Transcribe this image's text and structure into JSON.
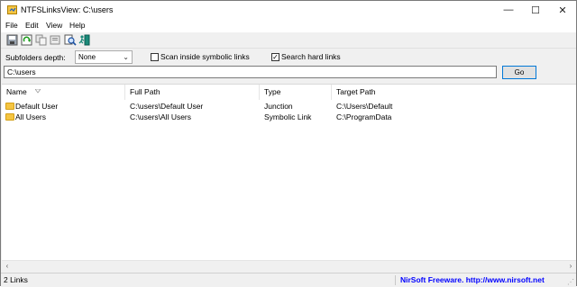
{
  "window": {
    "title": "NTFSLinksView:  C:\\users",
    "minimize": "—",
    "maximize": "☐",
    "close": "✕"
  },
  "menu": [
    "File",
    "Edit",
    "View",
    "Help"
  ],
  "toolbar_icons": [
    "save-icon",
    "refresh-icon",
    "copy-icon",
    "properties-icon",
    "find-icon",
    "exit-icon"
  ],
  "options": {
    "depth_label": "Subfolders depth:",
    "depth_value": "None",
    "scan_symbolic_label": "Scan inside symbolic links",
    "scan_symbolic_checked": false,
    "hard_links_label": "Search hard links",
    "hard_links_checked": true
  },
  "path": {
    "value": "C:\\users",
    "go_label": "Go"
  },
  "columns": [
    "Name",
    "Full Path",
    "Type",
    "Target Path"
  ],
  "rows": [
    {
      "name": "Default User",
      "full_path": "C:\\users\\Default User",
      "type": "Junction",
      "target": "C:\\Users\\Default"
    },
    {
      "name": "All Users",
      "full_path": "C:\\users\\All Users",
      "type": "Symbolic Link",
      "target": "C:\\ProgramData"
    }
  ],
  "status": {
    "count": "2 Links",
    "link": "NirSoft Freeware.  http://www.nirsoft.net"
  },
  "colors": {
    "folder": "#f5c542",
    "link": "#0000ff",
    "go_border": "#0078d7"
  }
}
